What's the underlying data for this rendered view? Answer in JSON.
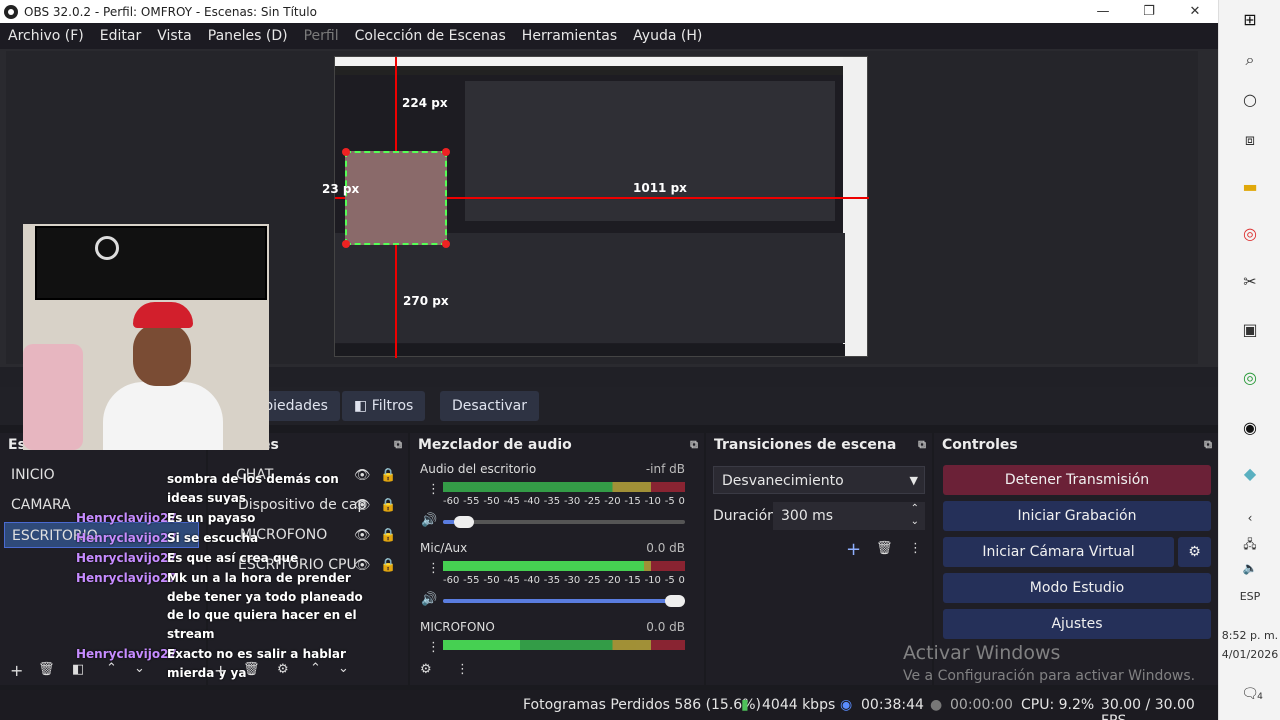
{
  "window": {
    "title": "OBS 32.0.2 - Perfil: OMFROY - Escenas: Sin Título"
  },
  "menu": {
    "items": [
      "Archivo (F)",
      "Editar",
      "Vista",
      "Paneles (D)",
      "Perfil",
      "Colección de Escenas",
      "Herramientas",
      "Ayuda (H)"
    ]
  },
  "preview": {
    "labels": {
      "top": "224 px",
      "left": "23 px",
      "right": "1011 px",
      "bottom": "270 px"
    }
  },
  "source_toolbar": {
    "properties": "Propiedades",
    "filters": "Filtros",
    "deactivate": "Desactivar"
  },
  "scenes": {
    "title": "Escenas",
    "items": [
      "INICIO",
      "CAMARA",
      "ESCRITORIO"
    ],
    "active_index": 2
  },
  "sources": {
    "title": "Fuentes",
    "items": [
      "CHAT",
      "Dispositivo de cap",
      "MICROFONO",
      "ESCRITORIO CPU"
    ]
  },
  "chat": {
    "lines": [
      {
        "user": "",
        "text": "sombra de los demás con"
      },
      {
        "user": "",
        "text": "ideas suyas"
      },
      {
        "user": "Henryclavijo27",
        "text": "Es un payaso"
      },
      {
        "user": "Henryclavijo27",
        "text": "Si se escucha"
      },
      {
        "user": "Henryclavijo27",
        "text": "Es que así crea que"
      },
      {
        "user": "Henryclavijo27",
        "text": "Mk un a la hora de prender"
      },
      {
        "user": "",
        "text": "debe tener ya todo planeado"
      },
      {
        "user": "",
        "text": "de lo que quiera hacer en el"
      },
      {
        "user": "",
        "text": "stream"
      },
      {
        "user": "Henryclavijo27",
        "text": "Exacto no es salir a hablar"
      },
      {
        "user": "",
        "text": "mierda y ya"
      }
    ]
  },
  "mixer": {
    "title": "Mezclador de audio",
    "channels": [
      {
        "name": "Audio del escritorio",
        "db": "-inf dB",
        "level": 0.0,
        "volume": 0.05
      },
      {
        "name": "Mic/Aux",
        "db": "0.0 dB",
        "level": 0.83,
        "volume": 1.0
      },
      {
        "name": "MICROFONO",
        "db": "0.0 dB",
        "level": 0.32,
        "volume": 1.0
      }
    ],
    "scale": [
      "-60",
      "-55",
      "-50",
      "-45",
      "-40",
      "-35",
      "-30",
      "-25",
      "-20",
      "-15",
      "-10",
      "-5",
      "0"
    ]
  },
  "transitions": {
    "title": "Transiciones de escena",
    "selected": "Desvanecimiento",
    "duration_label": "Duración",
    "duration_value": "300 ms"
  },
  "controls": {
    "title": "Controles",
    "stop_stream": "Detener Transmisión",
    "start_recording": "Iniciar Grabación",
    "start_virtual_cam": "Iniciar Cámara Virtual",
    "studio_mode": "Modo Estudio",
    "settings": "Ajustes"
  },
  "watermark": {
    "line1": "Activar Windows",
    "line2": "Ve a Configuración para activar Windows."
  },
  "status": {
    "dropped": "Fotogramas Perdidos 586 (15.6%)",
    "bitrate": "4044 kbps",
    "stream_time": "00:38:44",
    "rec_time": "00:00:00",
    "cpu": "CPU: 9.2%",
    "fps": "30.00 / 30.00 FPS"
  },
  "taskbar": {
    "lang": "ESP",
    "time": "8:52 p. m.",
    "date": "4/01/2026",
    "notif_count": "4"
  },
  "colors": {
    "stop_button": "#6b2137",
    "control_button": "#253059",
    "scene_active": "#2f4a79",
    "chat_user": "#c68cff"
  }
}
